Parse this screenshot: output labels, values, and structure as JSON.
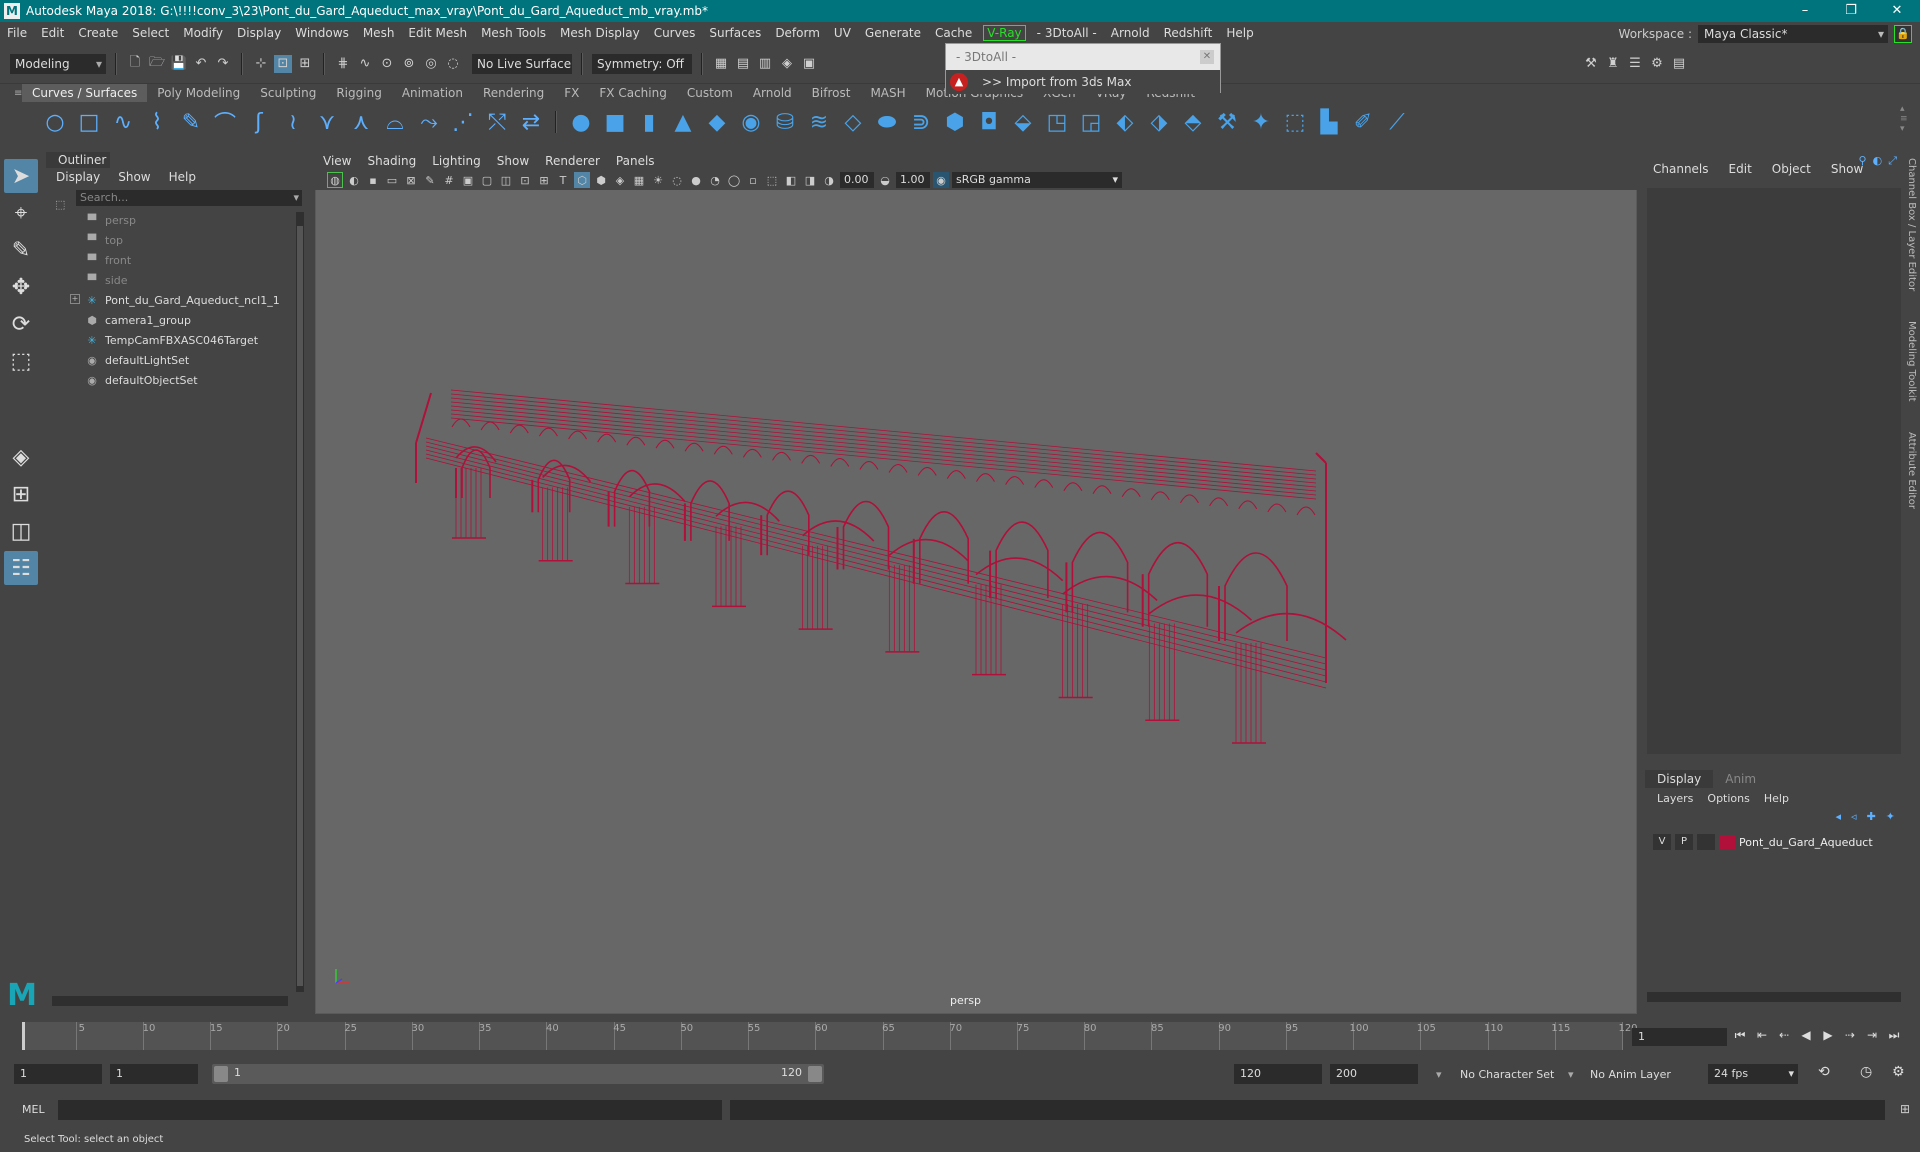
{
  "title": "Autodesk Maya 2018: G:\\!!!!conv_3\\23\\Pont_du_Gard_Aqueduct_max_vray\\Pont_du_Gard_Aqueduct_mb_vray.mb*",
  "menu": [
    "File",
    "Edit",
    "Create",
    "Select",
    "Modify",
    "Display",
    "Windows",
    "Mesh",
    "Edit Mesh",
    "Mesh Tools",
    "Mesh Display",
    "Curves",
    "Surfaces",
    "Deform",
    "UV",
    "Generate",
    "Cache",
    "V-Ray",
    "- 3DtoAll -",
    "Arnold",
    "Redshift",
    "Help"
  ],
  "workspace": {
    "label": "Workspace :",
    "value": "Maya Classic*"
  },
  "status": {
    "mode": "Modeling",
    "live_surface": "No Live Surface",
    "symmetry": "Symmetry: Off"
  },
  "popup": {
    "header": "- 3DtoAll -",
    "item": ">> Import from 3ds Max"
  },
  "shelf_tabs": [
    "Curves / Surfaces",
    "Poly Modeling",
    "Sculpting",
    "Rigging",
    "Animation",
    "Rendering",
    "FX",
    "FX Caching",
    "Custom",
    "Arnold",
    "Bifrost",
    "MASH",
    "Motion Graphics",
    "XGen",
    "VRay",
    "Redshift"
  ],
  "outliner": {
    "title": "Outliner",
    "menu": [
      "Display",
      "Show",
      "Help"
    ],
    "search_placeholder": "Search...",
    "items": [
      {
        "label": "persp",
        "icon": "camera-icon",
        "dim": true
      },
      {
        "label": "top",
        "icon": "camera-icon",
        "dim": true
      },
      {
        "label": "front",
        "icon": "camera-icon",
        "dim": true
      },
      {
        "label": "side",
        "icon": "camera-icon",
        "dim": true
      },
      {
        "label": "Pont_du_Gard_Aqueduct_ncl1_1",
        "icon": "transform-icon",
        "dim": false,
        "expandable": true
      },
      {
        "label": "camera1_group",
        "icon": "group-icon",
        "dim": false
      },
      {
        "label": "TempCamFBXASC046Target",
        "icon": "transform-icon",
        "dim": false
      },
      {
        "label": "defaultLightSet",
        "icon": "set-icon",
        "dim": false
      },
      {
        "label": "defaultObjectSet",
        "icon": "set-icon",
        "dim": false
      }
    ]
  },
  "viewport": {
    "menu": [
      "View",
      "Shading",
      "Lighting",
      "Show",
      "Renderer",
      "Panels"
    ],
    "exposure": "0.00",
    "gamma": "1.00",
    "color_space": "sRGB gamma",
    "camera_label": "persp",
    "wire_color": "#b0103a"
  },
  "channelbox": {
    "menu": [
      "Channels",
      "Edit",
      "Object",
      "Show"
    ]
  },
  "side_tabs": [
    "Channel Box / Layer Editor",
    "Modeling Toolkit",
    "Attribute Editor"
  ],
  "layers": {
    "tabs": [
      "Display",
      "Anim"
    ],
    "menu": [
      "Layers",
      "Options",
      "Help"
    ],
    "row": {
      "v": "V",
      "p": "P",
      "name": "Pont_du_Gard_Aqueduct",
      "color": "#b0103a"
    }
  },
  "timeline": {
    "labels": [
      "5",
      "10",
      "15",
      "20",
      "25",
      "30",
      "35",
      "40",
      "45",
      "50",
      "55",
      "60",
      "65",
      "70",
      "75",
      "80",
      "85",
      "90",
      "95",
      "100",
      "105",
      "110",
      "115",
      "120"
    ],
    "current_frame": "1"
  },
  "range": {
    "start": "1",
    "inner_start": "1",
    "slider_start": "1",
    "slider_end": "120",
    "end": "120",
    "outer_end": "200",
    "character_set": "No Character Set",
    "anim_layer": "No Anim Layer",
    "fps": "24 fps"
  },
  "cmd": {
    "label": "MEL"
  },
  "statusbar": "Select Tool: select an object"
}
